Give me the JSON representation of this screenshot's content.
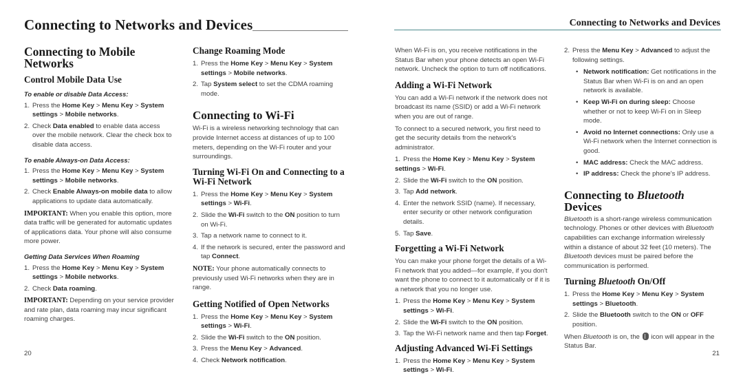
{
  "header": {
    "left_title": "Connecting to Networks and Devices",
    "right_title": "Connecting to Networks and Devices"
  },
  "page_numbers": {
    "left": "20",
    "right": "21"
  },
  "col1": {
    "h1": "Connecting to Mobile Networks",
    "h2": "Control Mobile Data Use",
    "sub1": "To enable or disable Data Access:",
    "list1": [
      {
        "num": "1.",
        "parts": [
          [
            "Press the ",
            0
          ],
          [
            "Home Key",
            1
          ],
          [
            " > ",
            0
          ],
          [
            "Menu Key",
            1
          ],
          [
            " > ",
            0
          ],
          [
            "System settings",
            1
          ],
          [
            " > ",
            0
          ],
          [
            "Mobile networks",
            1
          ],
          [
            ".",
            0
          ]
        ]
      },
      {
        "num": "2.",
        "parts": [
          [
            "Check ",
            0
          ],
          [
            "Data enabled",
            1
          ],
          [
            " to enable data access over the mobile network. Clear the check box to disable data access.",
            0
          ]
        ]
      }
    ],
    "sub2": "To enable Always-on Data Access:",
    "list2": [
      {
        "num": "1.",
        "parts": [
          [
            "Press the ",
            0
          ],
          [
            "Home Key",
            1
          ],
          [
            " > ",
            0
          ],
          [
            "Menu Key",
            1
          ],
          [
            " > ",
            0
          ],
          [
            "System settings",
            1
          ],
          [
            " > ",
            0
          ],
          [
            "Mobile networks",
            1
          ],
          [
            ".",
            0
          ]
        ]
      },
      {
        "num": "2.",
        "parts": [
          [
            "Check ",
            0
          ],
          [
            "Enable Always-on mobile data",
            1
          ],
          [
            " to allow applications to update data automatically.",
            0
          ]
        ]
      }
    ],
    "important1_label": "IMPORTANT:",
    "important1_text": " When you enable this option, more data traffic will be generated for automatic updates of applications data. Your phone will also consume more power.",
    "sub3": "Getting Data Services When Roaming",
    "list3": [
      {
        "num": "1.",
        "parts": [
          [
            "Press the ",
            0
          ],
          [
            "Home Key",
            1
          ],
          [
            " > ",
            0
          ],
          [
            "Menu Key",
            1
          ],
          [
            " > ",
            0
          ],
          [
            "System settings",
            1
          ],
          [
            " > ",
            0
          ],
          [
            "Mobile networks",
            1
          ],
          [
            ".",
            0
          ]
        ]
      },
      {
        "num": "2.",
        "parts": [
          [
            "Check ",
            0
          ],
          [
            "Data roaming",
            1
          ],
          [
            ".",
            0
          ]
        ]
      }
    ],
    "important2_label": "IMPORTANT:",
    "important2_text": " Depending on your service provider and rate plan, data roaming may incur significant roaming charges."
  },
  "col2": {
    "h2_roaming": "Change Roaming Mode",
    "list_roaming": [
      {
        "num": "1.",
        "parts": [
          [
            "Press the ",
            0
          ],
          [
            "Home Key",
            1
          ],
          [
            " > ",
            0
          ],
          [
            "Menu Key",
            1
          ],
          [
            " > ",
            0
          ],
          [
            "System settings",
            1
          ],
          [
            " > ",
            0
          ],
          [
            "Mobile networks",
            1
          ],
          [
            ".",
            0
          ]
        ]
      },
      {
        "num": "2.",
        "parts": [
          [
            "Tap ",
            0
          ],
          [
            "System select",
            1
          ],
          [
            " to set the CDMA roaming mode.",
            0
          ]
        ]
      }
    ],
    "h1_wifi": "Connecting to Wi-Fi",
    "wifi_intro": "Wi-Fi is a wireless networking technology that can provide Internet access at distances of up to 100 meters, depending on the Wi-Fi router and your surroundings.",
    "h2_turning": "Turning Wi-Fi On and Connecting to a Wi-Fi Network",
    "list_turning": [
      {
        "num": "1.",
        "parts": [
          [
            "Press the ",
            0
          ],
          [
            "Home Key",
            1
          ],
          [
            " > ",
            0
          ],
          [
            "Menu Key",
            1
          ],
          [
            " > ",
            0
          ],
          [
            "System settings",
            1
          ],
          [
            " > ",
            0
          ],
          [
            "Wi-Fi",
            1
          ],
          [
            ".",
            0
          ]
        ]
      },
      {
        "num": "2.",
        "parts": [
          [
            "Slide the ",
            0
          ],
          [
            "Wi-Fi",
            1
          ],
          [
            " switch to the ",
            0
          ],
          [
            "ON",
            1
          ],
          [
            " position to turn on Wi-Fi.",
            0
          ]
        ]
      },
      {
        "num": "3.",
        "parts": [
          [
            "Tap a network name to connect to it.",
            0
          ]
        ]
      },
      {
        "num": "4.",
        "parts": [
          [
            "If the network is secured, enter the password and tap ",
            0
          ],
          [
            "Connect",
            1
          ],
          [
            ".",
            0
          ]
        ]
      }
    ],
    "note_label": "NOTE:",
    "note_text": " Your phone automatically connects to previously used Wi-Fi networks when they are in range.",
    "h2_notified": "Getting Notified of Open Networks",
    "list_notified": [
      {
        "num": "1.",
        "parts": [
          [
            "Press the ",
            0
          ],
          [
            "Home Key",
            1
          ],
          [
            " > ",
            0
          ],
          [
            "Menu Key",
            1
          ],
          [
            " > ",
            0
          ],
          [
            "System settings",
            1
          ],
          [
            " > ",
            0
          ],
          [
            "Wi-Fi",
            1
          ],
          [
            ".",
            0
          ]
        ]
      },
      {
        "num": "2.",
        "parts": [
          [
            "Slide the ",
            0
          ],
          [
            "Wi-Fi",
            1
          ],
          [
            " switch to the ",
            0
          ],
          [
            "ON",
            1
          ],
          [
            " position.",
            0
          ]
        ]
      },
      {
        "num": "3.",
        "parts": [
          [
            "Press the ",
            0
          ],
          [
            "Menu Key",
            1
          ],
          [
            " > ",
            0
          ],
          [
            "Advanced",
            1
          ],
          [
            ".",
            0
          ]
        ]
      },
      {
        "num": "4.",
        "parts": [
          [
            "Check ",
            0
          ],
          [
            "Network notification",
            1
          ],
          [
            ".",
            0
          ]
        ]
      }
    ]
  },
  "col3": {
    "notify_text": "When Wi-Fi is on, you receive notifications in the Status Bar when your phone detects an open Wi-Fi network. Uncheck the option to turn off notifications.",
    "h2_adding": "Adding a Wi-Fi Network",
    "adding_p1": "You can add a Wi-Fi network if the network does not broadcast its name (SSID) or add a Wi-Fi network when you are out of range.",
    "adding_p2": "To connect to a secured network, you first need to get the security details from the network's administrator.",
    "list_adding": [
      {
        "num": "1.",
        "flush": true,
        "parts": [
          [
            "Press the ",
            0
          ],
          [
            "Home Key",
            1
          ],
          [
            " > ",
            0
          ],
          [
            "Menu Key",
            1
          ],
          [
            " > ",
            0
          ],
          [
            "System settings",
            1
          ],
          [
            " > ",
            0
          ],
          [
            "Wi-Fi",
            1
          ],
          [
            ".",
            0
          ]
        ]
      },
      {
        "num": "2.",
        "parts": [
          [
            "Slide the ",
            0
          ],
          [
            "Wi-Fi",
            1
          ],
          [
            " switch to the ",
            0
          ],
          [
            "ON",
            1
          ],
          [
            " position.",
            0
          ]
        ]
      },
      {
        "num": "3.",
        "parts": [
          [
            "Tap ",
            0
          ],
          [
            "Add network",
            1
          ],
          [
            ".",
            0
          ]
        ]
      },
      {
        "num": "4.",
        "parts": [
          [
            "Enter the network SSID (name). If necessary, enter security or other network configuration details.",
            0
          ]
        ]
      },
      {
        "num": "5.",
        "parts": [
          [
            "Tap ",
            0
          ],
          [
            "Save",
            1
          ],
          [
            ".",
            0
          ]
        ]
      }
    ],
    "h2_forgetting": "Forgetting a Wi-Fi Network",
    "forgetting_p": "You can make your phone forget the details of a Wi-Fi network that you added—for example, if you don't want the phone to connect to it automatically or if it is a network that you no longer use.",
    "list_forgetting": [
      {
        "num": "1.",
        "parts": [
          [
            "Press the ",
            0
          ],
          [
            "Home Key",
            1
          ],
          [
            " > ",
            0
          ],
          [
            "Menu Key",
            1
          ],
          [
            " > ",
            0
          ],
          [
            "System settings",
            1
          ],
          [
            " > ",
            0
          ],
          [
            "Wi-Fi",
            1
          ],
          [
            ".",
            0
          ]
        ]
      },
      {
        "num": "2.",
        "parts": [
          [
            "Slide the ",
            0
          ],
          [
            "Wi-Fi",
            1
          ],
          [
            " switch to the ",
            0
          ],
          [
            "ON",
            1
          ],
          [
            " position.",
            0
          ]
        ]
      },
      {
        "num": "3.",
        "parts": [
          [
            "Tap the Wi-Fi network name and then tap ",
            0
          ],
          [
            "Forget",
            1
          ],
          [
            ".",
            0
          ]
        ]
      }
    ],
    "h2_advanced": "Adjusting Advanced Wi-Fi Settings",
    "list_advanced": [
      {
        "num": "1.",
        "parts": [
          [
            "Press the ",
            0
          ],
          [
            "Home Key",
            1
          ],
          [
            " > ",
            0
          ],
          [
            "Menu Key",
            1
          ],
          [
            " > ",
            0
          ],
          [
            "System settings",
            1
          ],
          [
            " > ",
            0
          ],
          [
            "Wi-Fi",
            1
          ],
          [
            ".",
            0
          ]
        ]
      }
    ]
  },
  "col4": {
    "list_advanced_cont": [
      {
        "num": "2.",
        "parts": [
          [
            "Press the ",
            0
          ],
          [
            "Menu Key",
            1
          ],
          [
            " > ",
            0
          ],
          [
            "Advanced",
            1
          ],
          [
            " to adjust the following settings.",
            0
          ]
        ]
      }
    ],
    "bullets": [
      {
        "label": "Network notification:",
        "text": " Get notifications in the Status Bar when Wi-Fi is on and an open network is available."
      },
      {
        "label": "Keep Wi-Fi on during sleep:",
        "text": " Choose whether or not to keep Wi-Fi on in Sleep mode."
      },
      {
        "label": "Avoid no Internet connections:",
        "text": " Only use a Wi-Fi network when the Internet connection is good."
      },
      {
        "label": "MAC address:",
        "text": " Check the MAC address."
      },
      {
        "label": "IP address:",
        "text": " Check the phone's IP address."
      }
    ],
    "h1_bt_prefix": "Connecting to ",
    "h1_bt_italic": "Bluetooth",
    "h1_bt_suffix": "Devices",
    "bt_intro_parts": [
      [
        "Bluetooth",
        2
      ],
      [
        " is a short-range wireless communication technology. Phones or other devices with ",
        0
      ],
      [
        "Bluetooth",
        2
      ],
      [
        " capabilities can exchange information wirelessly within a distance of about 32 feet (10 meters). The ",
        0
      ],
      [
        "Bluetooth",
        2
      ],
      [
        " devices must be paired before the communication is performed.",
        0
      ]
    ],
    "h2_turning_prefix": "Turning ",
    "h2_turning_italic": "Bluetooth",
    "h2_turning_suffix": " On/Off",
    "list_bt": [
      {
        "num": "1.",
        "parts": [
          [
            "Press the ",
            0
          ],
          [
            "Home Key",
            1
          ],
          [
            " > ",
            0
          ],
          [
            "Menu Key",
            1
          ],
          [
            " > ",
            0
          ],
          [
            "System settings",
            1
          ],
          [
            " > ",
            0
          ],
          [
            "Bluetooth",
            1
          ],
          [
            ".",
            0
          ]
        ]
      },
      {
        "num": "2.",
        "parts": [
          [
            "Slide the ",
            0
          ],
          [
            "Bluetooth",
            1
          ],
          [
            " switch to the ",
            0
          ],
          [
            "ON",
            1
          ],
          [
            " or ",
            0
          ],
          [
            "OFF",
            1
          ],
          [
            " position.",
            0
          ]
        ]
      }
    ],
    "bt_status_before_italic": "When ",
    "bt_status_italic": "Bluetooth",
    "bt_status_mid": " is on, the ",
    "bt_status_icon": "bluetooth-icon",
    "bt_status_after": " icon will appear in the Status Bar."
  }
}
